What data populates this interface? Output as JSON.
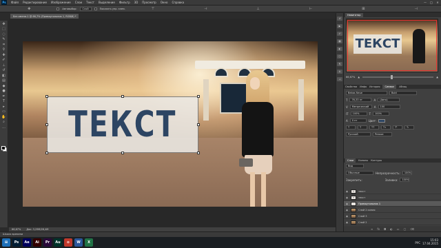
{
  "app": {
    "logo": "Ps"
  },
  "menu": [
    "Файл",
    "Редактирование",
    "Изображение",
    "Слои",
    "Текст",
    "Выделение",
    "Фильтр",
    "3D",
    "Просмотр",
    "Окно",
    "Справка"
  ],
  "window_controls": {
    "minimize": "—",
    "maximize": "□",
    "close": "✕"
  },
  "options_bar": {
    "auto_select_label": "Автовыбор:",
    "auto_select_value": "Слой",
    "show_controls_label": "Показать упр. элем."
  },
  "document_tab": {
    "title": "Без имени-1 @ 66,7% (Прямоугольник 1, RGB/8) *"
  },
  "canvas": {
    "overlay_text": "ТЕКСТ"
  },
  "status_bar": {
    "zoom": "66,67%",
    "doc_info": "Док: 3,29М/26,4М"
  },
  "timeline": {
    "label": "Шкала времени"
  },
  "navigator": {
    "tabs": [
      "Навигатор"
    ],
    "thumb_text": "ТЕКСТ",
    "zoom_value": "66,67%"
  },
  "properties_tabs": [
    "Свойства",
    "Инфо",
    "История",
    "Символ",
    "Абзац"
  ],
  "character": {
    "font_family": "Bebas Neue",
    "font_style": "Bold",
    "font_size": "76,33 пт",
    "leading": "(Авто)",
    "kerning": "Метрический",
    "tracking": "100",
    "vertical_scale": "100%",
    "horizontal_scale": "100%",
    "baseline": "0 пт",
    "color_label": "Цвет:",
    "language": "Русский",
    "antialias": "Резкое"
  },
  "layers": {
    "tabs": [
      "Слои",
      "Каналы",
      "Контуры"
    ],
    "kind": "Вид",
    "blend_mode": "Обычные",
    "opacity_label": "Непрозрачность:",
    "opacity": "100%",
    "fill_label": "Заливка:",
    "fill": "100%",
    "lock_label": "Закрепить:",
    "items": [
      {
        "name": "текст",
        "thumb": "T",
        "active": false,
        "photo": false
      },
      {
        "name": "текст",
        "thumb": "T",
        "active": false,
        "photo": false
      },
      {
        "name": "Прямоугольник 1",
        "thumb": "",
        "active": true,
        "photo": false
      },
      {
        "name": "Слой 2 копия",
        "thumb": "",
        "active": false,
        "photo": true
      },
      {
        "name": "Слой 3",
        "thumb": "",
        "active": false,
        "photo": true
      },
      {
        "name": "Слой 2",
        "thumb": "",
        "active": false,
        "photo": true
      }
    ]
  },
  "taskbar": {
    "apps": [
      {
        "label": "Ps",
        "color": "#001d34"
      },
      {
        "label": "Ae",
        "color": "#00005b"
      },
      {
        "label": "Ai",
        "color": "#330000"
      },
      {
        "label": "Pr",
        "color": "#2a0a3a"
      },
      {
        "label": "Au",
        "color": "#00332a"
      },
      {
        "label": "⊙",
        "color": "#c0392b"
      },
      {
        "label": "W",
        "color": "#2b579a"
      },
      {
        "label": "X",
        "color": "#217346"
      }
    ],
    "language": "РУС",
    "time": "15:03",
    "date": "17.04.2015"
  },
  "colors": {
    "accent_text": "#2d4563",
    "selection_red": "#e03030"
  }
}
